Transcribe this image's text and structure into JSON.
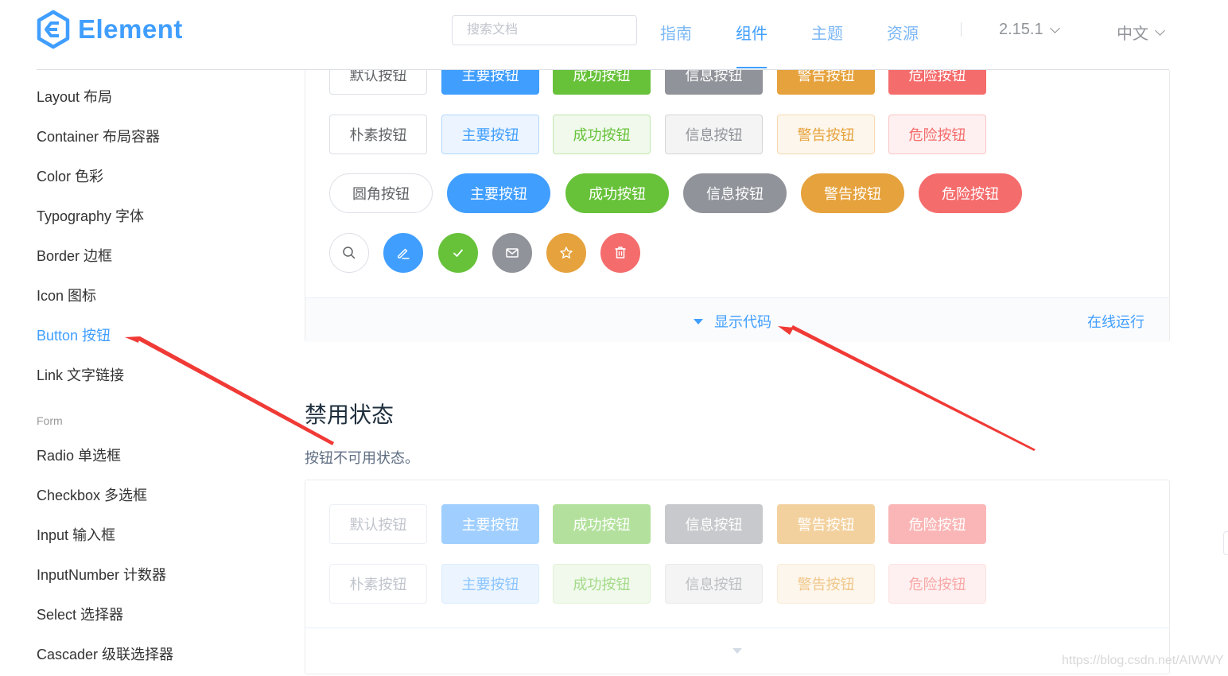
{
  "header": {
    "brand": "Element",
    "search_placeholder": "搜索文档",
    "nav": [
      "指南",
      "组件",
      "主题",
      "资源"
    ],
    "version": "2.15.1",
    "language": "中文"
  },
  "sidebar": {
    "items": [
      "Layout 布局",
      "Container 布局容器",
      "Color 色彩",
      "Typography 字体",
      "Border 边框",
      "Icon 图标",
      "Button 按钮",
      "Link 文字链接"
    ],
    "group_label": "Form",
    "form_items": [
      "Radio 单选框",
      "Checkbox 多选框",
      "Input 输入框",
      "InputNumber 计数器",
      "Select 选择器",
      "Cascader 级联选择器"
    ]
  },
  "demo1": {
    "default_row": [
      "默认按钮",
      "主要按钮",
      "成功按钮",
      "信息按钮",
      "警告按钮",
      "危险按钮"
    ],
    "plain_row": [
      "朴素按钮",
      "主要按钮",
      "成功按钮",
      "信息按钮",
      "警告按钮",
      "危险按钮"
    ],
    "round_row": [
      "圆角按钮",
      "主要按钮",
      "成功按钮",
      "信息按钮",
      "警告按钮",
      "危险按钮"
    ],
    "circle_icons": [
      "search-icon",
      "edit-icon",
      "check-icon",
      "message-icon",
      "star-icon",
      "delete-icon"
    ],
    "show_code": "显示代码",
    "run_online": "在线运行"
  },
  "section": {
    "title": "禁用状态",
    "desc": "按钮不可用状态。"
  },
  "demo2": {
    "default_row": [
      "默认按钮",
      "主要按钮",
      "成功按钮",
      "信息按钮",
      "警告按钮",
      "危险按钮"
    ],
    "plain_row": [
      "朴素按钮",
      "主要按钮",
      "成功按钮",
      "信息按钮",
      "警告按钮",
      "危险按钮"
    ]
  },
  "watermark": "https://blog.csdn.net/AIWWY",
  "colors": {
    "primary": "#409eff",
    "success": "#67c23a",
    "info": "#909399",
    "warning": "#e6a23c",
    "danger": "#f56c6c",
    "annotation_arrow": "#f03a36"
  }
}
